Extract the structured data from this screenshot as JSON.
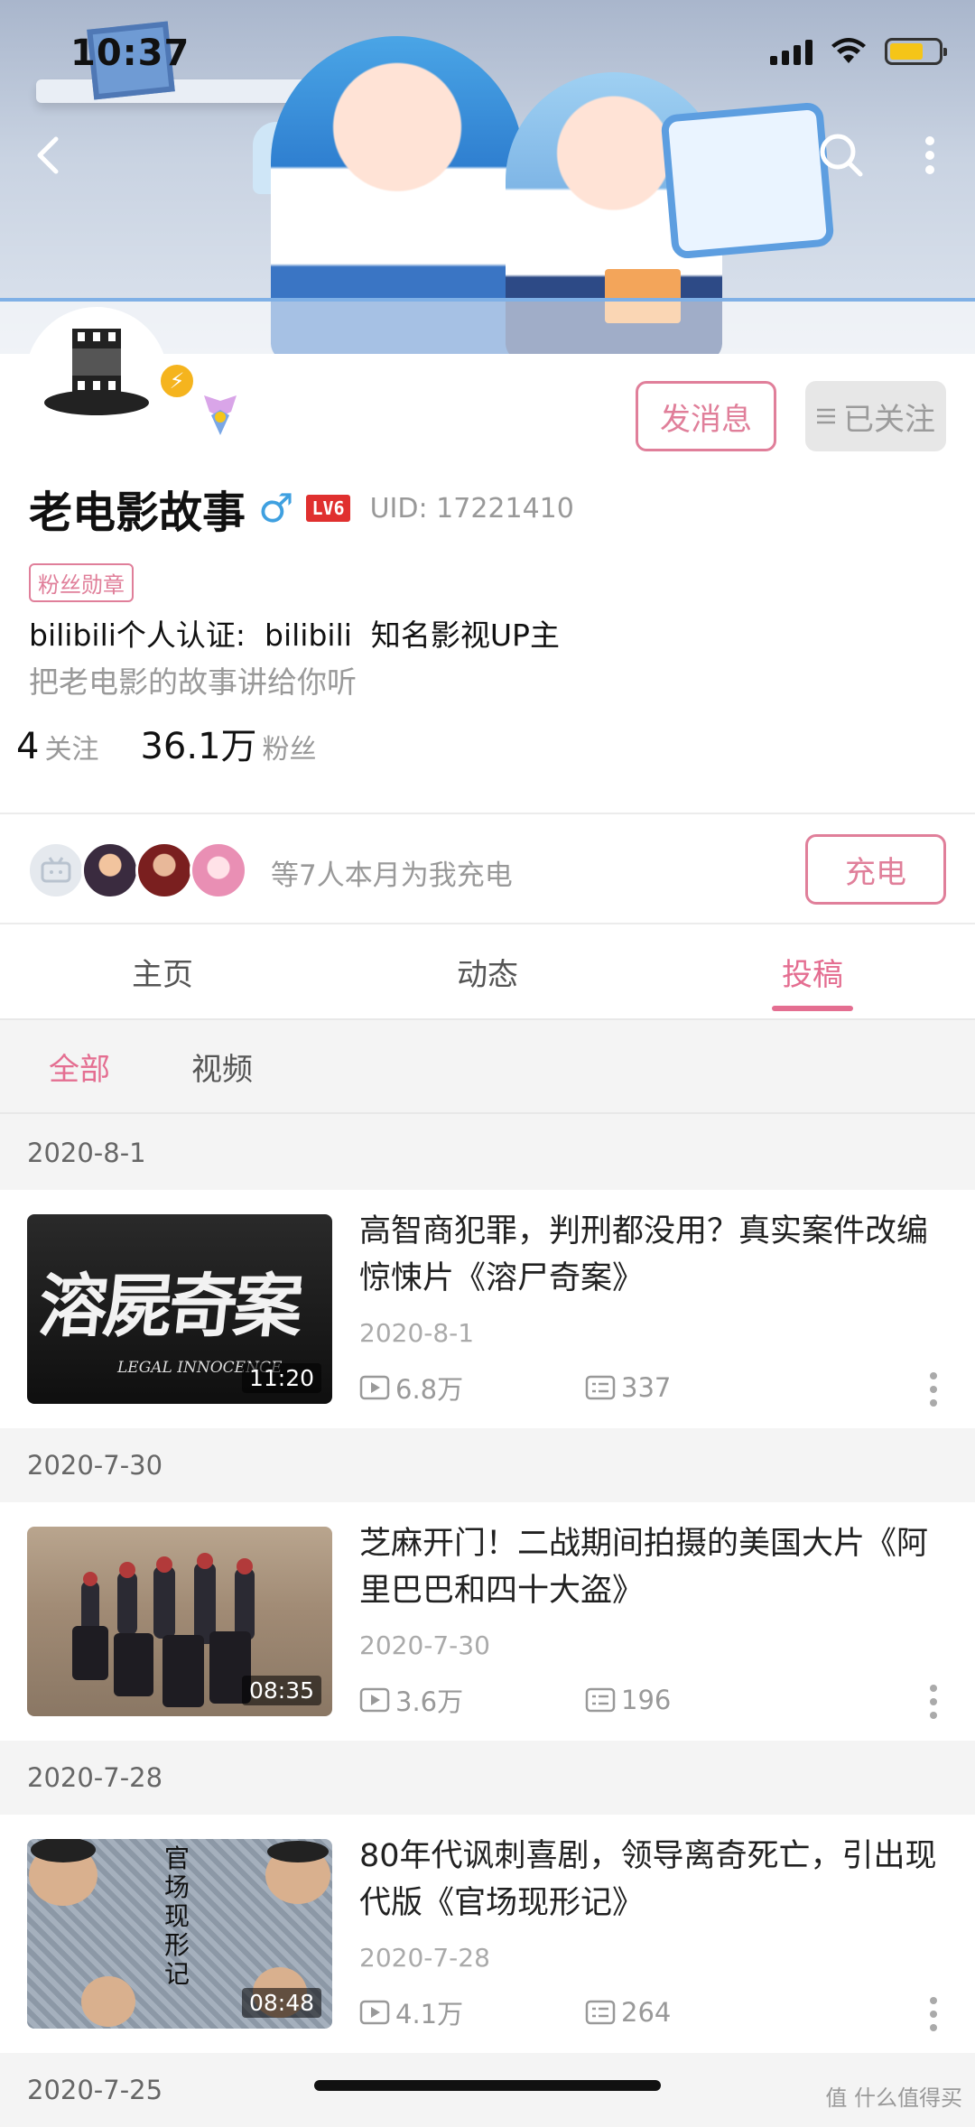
{
  "status_bar": {
    "time": "10:37"
  },
  "banner": {
    "back_icon": "chevron-left-icon",
    "search_icon": "search-icon",
    "more_icon": "more-vertical-icon"
  },
  "profile": {
    "name": "老电影故事",
    "gender_symbol": "♂",
    "level": "LV6",
    "uid": "UID:  17221410",
    "medal": "粉丝勋章",
    "certification": "bilibili个人认证:  bilibili  知名影视UP主",
    "signature": "把老电影的故事讲给你听",
    "following_count": "4",
    "following_label": "关注",
    "fans_count": "36.1万",
    "fans_label": "粉丝",
    "message_button": "发消息",
    "follow_button": "已关注",
    "verify_icon": "⚡"
  },
  "charge": {
    "text": "等7人本月为我充电",
    "button": "充电"
  },
  "tabs": [
    {
      "label": "主页"
    },
    {
      "label": "动态"
    },
    {
      "label": "投稿"
    }
  ],
  "subtabs": [
    {
      "label": "全部"
    },
    {
      "label": "视频"
    }
  ],
  "videos": [
    {
      "date_header": "2020-8-1",
      "title": "高智商犯罪，判刑都没用？真实案件改编惊悚片《溶尸奇案》",
      "date": "2020-8-1",
      "duration": "11:20",
      "plays": "6.8万",
      "comments": "337",
      "thumb_text": "溶屍奇案",
      "thumb_subtext": "LEGAL INNOCENCE"
    },
    {
      "date_header": "2020-7-30",
      "title": "芝麻开门！二战期间拍摄的美国大片《阿里巴巴和四十大盗》",
      "date": "2020-7-30",
      "duration": "08:35",
      "plays": "3.6万",
      "comments": "196"
    },
    {
      "date_header": "2020-7-28",
      "title": "80年代讽刺喜剧，领导离奇死亡，引出现代版《官场现形记》",
      "date": "2020-7-28",
      "duration": "08:48",
      "plays": "4.1万",
      "comments": "264",
      "thumb_text": "官场现形记"
    }
  ],
  "next_date_header": "2020-7-25",
  "watermark": "值 什么值得买",
  "colors": {
    "accent": "#e46e91",
    "gender": "#3fa0e0",
    "level": "#e0302f",
    "verify": "#f5b41e"
  }
}
